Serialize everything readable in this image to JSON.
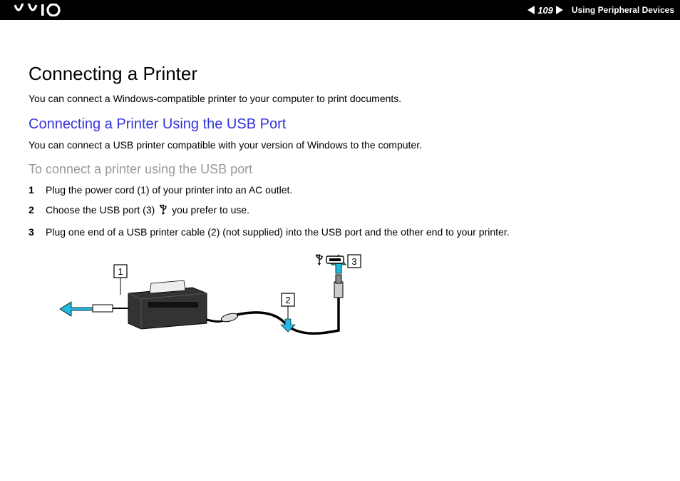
{
  "header": {
    "page_number": "109",
    "section": "Using Peripheral Devices"
  },
  "content": {
    "title": "Connecting a Printer",
    "intro": "You can connect a Windows-compatible printer to your computer to print documents.",
    "subtitle": "Connecting a Printer Using the USB Port",
    "sub_intro": "You can connect a USB printer compatible with your version of Windows to the computer.",
    "task_heading": "To connect a printer using the USB port",
    "steps": [
      {
        "num": "1",
        "text": "Plug the power cord (1) of your printer into an AC outlet."
      },
      {
        "num": "2",
        "text_before": "Choose the USB port (3) ",
        "text_after": " you prefer to use.",
        "has_icon": true
      },
      {
        "num": "3",
        "text": "Plug one end of a USB printer cable (2) (not supplied) into the USB port and the other end to your printer."
      }
    ],
    "diagram_labels": {
      "label1": "1",
      "label2": "2",
      "label3": "3"
    }
  }
}
